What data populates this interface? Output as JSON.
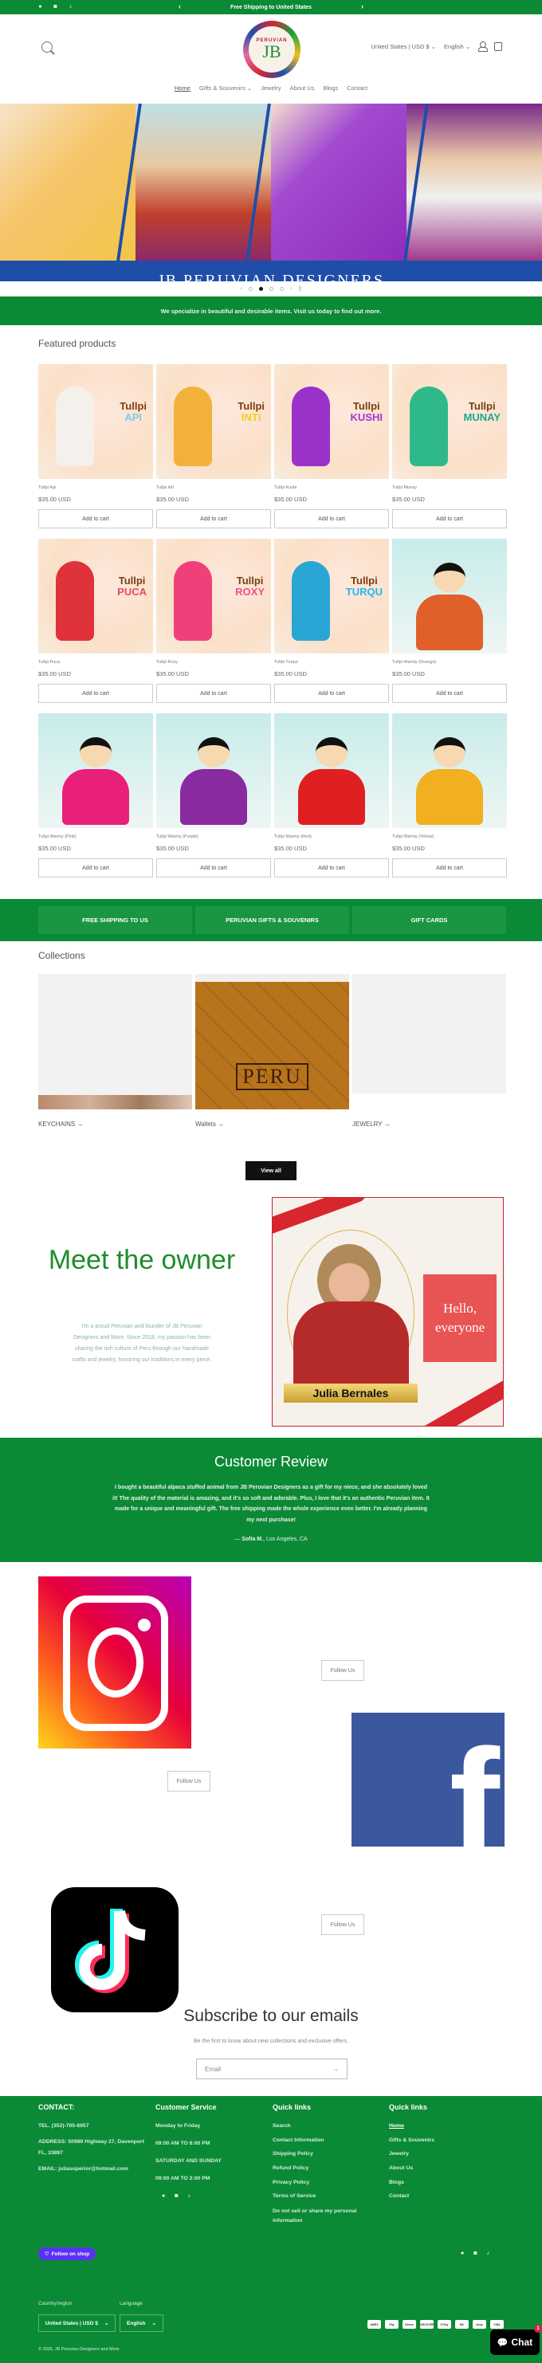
{
  "announcement": {
    "text": "Free Shipping to United States",
    "prev": "‹",
    "next": "›",
    "social": [
      "facebook-icon",
      "instagram-icon",
      "tiktok-icon"
    ]
  },
  "header": {
    "logo": {
      "arc_text": "PERUVIAN",
      "monogram": "JB"
    },
    "country": "United States | USD $",
    "language": "English",
    "nav": [
      "Home",
      "Gifts & Souvenirs",
      "Jewelry",
      "About Us",
      "Blogs",
      "Contact"
    ],
    "active_nav": "Home"
  },
  "hero": {
    "title": "JB PERUVIAN DESIGNERS",
    "slide_count": 4,
    "active_slide": 2,
    "prev": "‹",
    "next": "›",
    "pause": "||"
  },
  "tagline": "We specialize in beautiful and desirable items. Visit us today to find out more.",
  "featured": {
    "title": "Featured products",
    "add_to_cart": "Add to cart",
    "products": [
      {
        "name": "Tullpi Api",
        "price": "$35.00 USD",
        "label": "API",
        "color": "#f4f1ec",
        "accent": "#7ec8ef",
        "kind": "llama"
      },
      {
        "name": "Tullpi Inti",
        "price": "$35.00 USD",
        "label": "INTI",
        "color": "#f2b23a",
        "accent": "#f0d020",
        "kind": "llama"
      },
      {
        "name": "Tullpi Kushi",
        "price": "$35.00 USD",
        "label": "KUSHI",
        "color": "#9a32c9",
        "accent": "#a236d6",
        "kind": "llama"
      },
      {
        "name": "Tullpi Munay",
        "price": "$35.00 USD",
        "label": "MUNAY",
        "color": "#2fb98a",
        "accent": "#1aa98a",
        "kind": "llama"
      },
      {
        "name": "Tullpi Puca",
        "price": "$35.00 USD",
        "label": "PUCA",
        "color": "#e0323a",
        "accent": "#e84a66",
        "kind": "llama"
      },
      {
        "name": "Tullpi Roxy",
        "price": "$35.00 USD",
        "label": "ROXY",
        "color": "#f0407a",
        "accent": "#f0508a",
        "kind": "llama"
      },
      {
        "name": "Tullpi Turqui",
        "price": "$35.00 USD",
        "label": "TURQU",
        "color": "#2aa6d4",
        "accent": "#22b8f0",
        "kind": "llama"
      },
      {
        "name": "Tullpi Warmy (Orange)",
        "price": "$35.00 USD",
        "label": "",
        "color": "#e0602a",
        "accent": "",
        "kind": "doll"
      },
      {
        "name": "Tullpi Warmy (Pink)",
        "price": "$35.00 USD",
        "label": "",
        "color": "#e8207a",
        "accent": "",
        "kind": "doll"
      },
      {
        "name": "Tullpi Warmy (Purple)",
        "price": "$35.00 USD",
        "label": "",
        "color": "#8a2aa0",
        "accent": "",
        "kind": "doll"
      },
      {
        "name": "Tullpi Warmy (Red)",
        "price": "$35.00 USD",
        "label": "",
        "color": "#e02020",
        "accent": "",
        "kind": "doll"
      },
      {
        "name": "Tullpi Warmy (Yellow)",
        "price": "$35.00 USD",
        "label": "",
        "color": "#f0b020",
        "accent": "",
        "kind": "doll"
      }
    ]
  },
  "promo_blocks": [
    "FREE SHIPPING TO US",
    "PERUVIAN GIFTS & SOUVENIRS",
    "GIFT CARDS"
  ],
  "collections": {
    "title": "Collections",
    "items": [
      {
        "label": "KEYCHAINS →"
      },
      {
        "label": "Wallets →"
      },
      {
        "label": "JEWELRY →"
      }
    ],
    "wallet_text": "PERU",
    "view_all": "View all"
  },
  "owner": {
    "title": "Meet the owner",
    "text": "I'm a proud Peruvian and founder of JB Peruvian Designers and More. Since 2018, my passion has been sharing the rich culture of Peru through our handmade crafts and jewelry, honoring our traditions in every piece.",
    "card_greeting": "Hello, everyone",
    "card_name": "Julia Bernales"
  },
  "review": {
    "title": "Customer Review",
    "text": "I bought a beautiful alpaca stuffed animal from JB Peruvian Designers as a gift for my niece, and she absolutely loved it! The quality of the material is amazing, and it's so soft and adorable. Plus, I love that it's an authentic Peruvian item. It made for a unique and meaningful gift. The free shipping made the whole experience even better. I'm already planning my next purchase!",
    "author": "Sofia M.",
    "location": ", Los Angeles, CA",
    "dash": "— "
  },
  "social_follow": {
    "label": "Follow Us",
    "fb_glyph": "f"
  },
  "subscribe": {
    "title": "Subscribe to our emails",
    "text": "Be the first to know about new collections and exclusive offers.",
    "placeholder": "Email",
    "arrow": "→"
  },
  "footer": {
    "contact": {
      "title": "CONTACT:",
      "lines": [
        "TEL. (352)-705-6957",
        "ADDRESS: 50989 Highway 27, Davenport FL, 33897",
        "EMAIL: juliasuperior@hotmail.com"
      ]
    },
    "service": {
      "title": "Customer Service",
      "lines": [
        "Monday to Friday",
        "09:00 AM TO 6:00 PM",
        "SATURDAY AND SUNDAY",
        "09:00 AM TO 2:00 PM"
      ]
    },
    "quick1": {
      "title": "Quick links",
      "links": [
        "Search",
        "Contact Information",
        "Shipping Policy",
        "Refund Policy",
        "Privacy Policy",
        "Terms of Service",
        "Do not sell or share my personal information"
      ]
    },
    "quick2": {
      "title": "Quick links",
      "links": [
        "Home",
        "Gifts & Souvenirs",
        "Jewelry",
        "About Us",
        "Blogs",
        "Contact"
      ]
    },
    "follow_shop": "Follow on shop",
    "country_label": "Country/region",
    "country_value": "United States | USD $",
    "language_label": "Language",
    "language_value": "English",
    "payments": [
      "AMEX",
      "Pay",
      "Diners",
      "DISCOVER",
      "G Pay",
      "MC",
      "shop",
      "VISA"
    ],
    "copyright": "© 2025, JB Peruvian Designers and More"
  },
  "chat": {
    "label": "Chat",
    "badge": "1"
  }
}
